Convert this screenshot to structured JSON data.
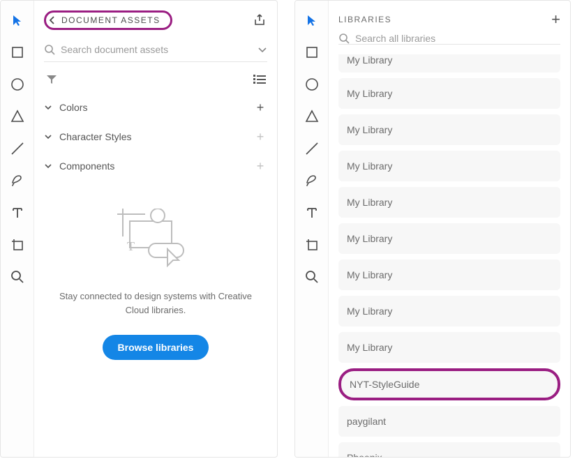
{
  "left": {
    "header": {
      "title": "DOCUMENT ASSETS"
    },
    "search": {
      "placeholder": "Search document assets"
    },
    "sections": [
      {
        "label": "Colors",
        "plus_muted": false
      },
      {
        "label": "Character Styles",
        "plus_muted": true
      },
      {
        "label": "Components",
        "plus_muted": true
      }
    ],
    "empty": {
      "text": "Stay connected to design systems with Creative Cloud libraries.",
      "cta": "Browse libraries"
    }
  },
  "right": {
    "header": {
      "title": "LIBRARIES"
    },
    "search": {
      "placeholder": "Search all libraries"
    },
    "items": [
      {
        "label": "My Library"
      },
      {
        "label": "My Library"
      },
      {
        "label": "My Library"
      },
      {
        "label": "My Library"
      },
      {
        "label": "My Library"
      },
      {
        "label": "My Library"
      },
      {
        "label": "My Library"
      },
      {
        "label": "My Library"
      },
      {
        "label": "My Library"
      },
      {
        "label": "NYT-StyleGuide",
        "highlighted": true
      },
      {
        "label": "paygilant"
      },
      {
        "label": "Phoenix"
      }
    ]
  },
  "tools": [
    {
      "name": "select",
      "active": true
    },
    {
      "name": "rectangle"
    },
    {
      "name": "ellipse"
    },
    {
      "name": "polygon"
    },
    {
      "name": "line"
    },
    {
      "name": "pen"
    },
    {
      "name": "text"
    },
    {
      "name": "artboard"
    },
    {
      "name": "zoom"
    }
  ]
}
